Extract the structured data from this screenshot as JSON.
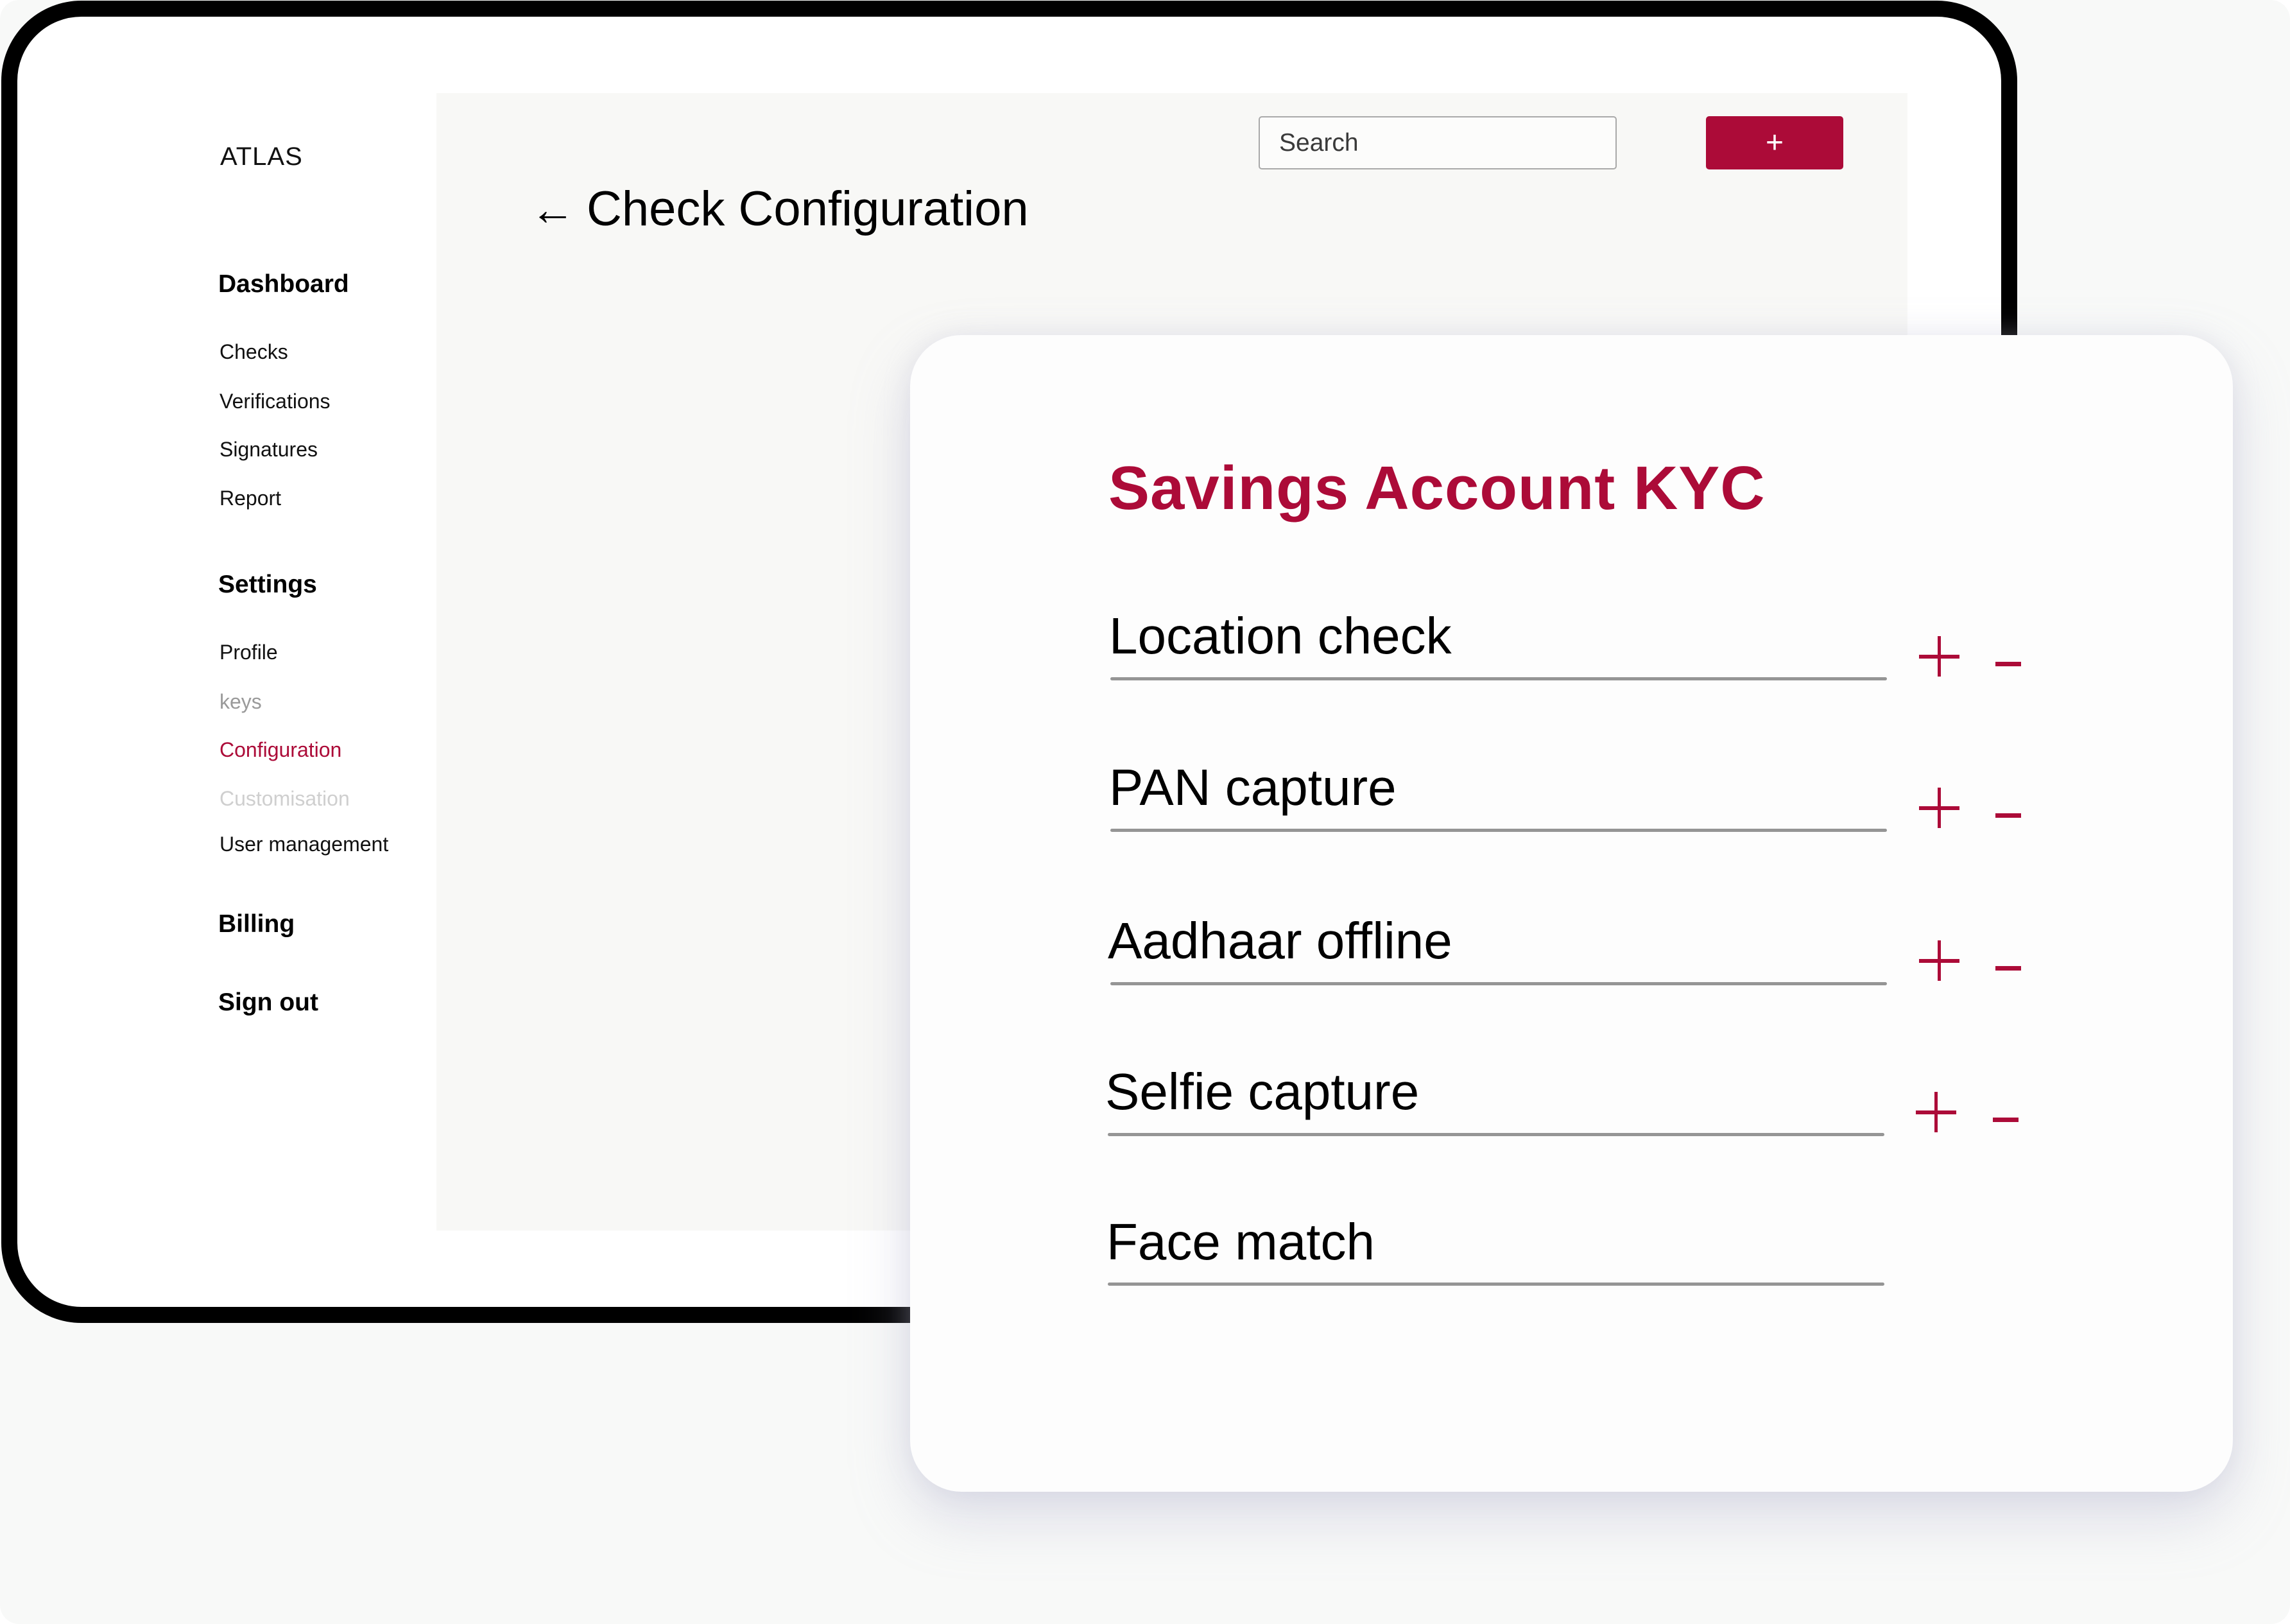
{
  "app": {
    "logo": "ATLAS"
  },
  "colors": {
    "accent": "#AC0B38",
    "panel": "#F8F8F6",
    "underline": "#959595"
  },
  "sidebar": {
    "dashboard": {
      "heading": "Dashboard",
      "items": [
        {
          "label": "Checks",
          "state": "normal"
        },
        {
          "label": "Verifications",
          "state": "normal"
        },
        {
          "label": "Signatures",
          "state": "normal"
        },
        {
          "label": "Report",
          "state": "normal"
        }
      ]
    },
    "settings": {
      "heading": "Settings",
      "items": [
        {
          "label": "Profile",
          "state": "normal"
        },
        {
          "label": "keys",
          "state": "disabled"
        },
        {
          "label": "Configuration",
          "state": "active"
        },
        {
          "label": "Customisation",
          "state": "disabled"
        },
        {
          "label": "User management",
          "state": "normal"
        }
      ]
    },
    "billing": "Billing",
    "sign_out": "Sign out"
  },
  "header": {
    "back_icon": "arrow-left-icon",
    "title": "Check Configuration",
    "search": {
      "placeholder": "Search",
      "value": "",
      "icon": "search-icon"
    },
    "add_button_label": "+"
  },
  "card": {
    "title": "Savings Account KYC",
    "checks": [
      {
        "label": "Location check",
        "controls": true
      },
      {
        "label": "PAN capture",
        "controls": true
      },
      {
        "label": "Aadhaar offline",
        "controls": true
      },
      {
        "label": "Selfie capture",
        "controls": true
      },
      {
        "label": "Face match",
        "controls": false
      }
    ]
  }
}
